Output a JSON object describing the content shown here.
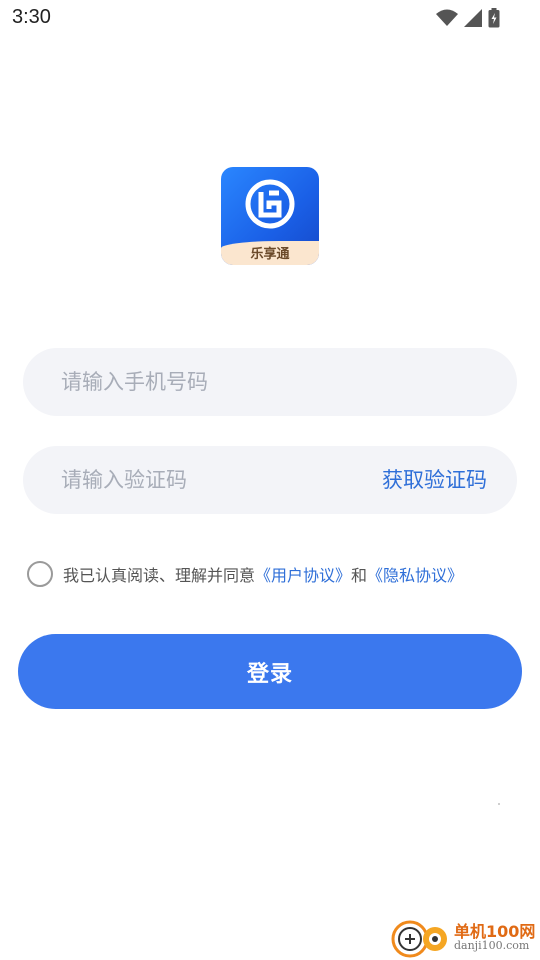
{
  "status_bar": {
    "time": "3:30",
    "icons": [
      "wifi-icon",
      "signal-icon",
      "battery-charging-icon"
    ]
  },
  "logo": {
    "app_name": "乐享通"
  },
  "form": {
    "phone_placeholder": "请输入手机号码",
    "code_placeholder": "请输入验证码",
    "get_code_label": "获取验证码"
  },
  "agreement": {
    "prefix": "我已认真阅读、理解并同意",
    "user_agreement": "《用户协议》",
    "joiner": "和",
    "privacy_agreement": "《隐私协议》"
  },
  "login_button_label": "登录",
  "watermark": {
    "title": "单机100网",
    "url": "danji100.com"
  },
  "colors": {
    "accent": "#3b78ee",
    "link": "#2f6fd8",
    "input_bg": "#f3f4f8"
  }
}
